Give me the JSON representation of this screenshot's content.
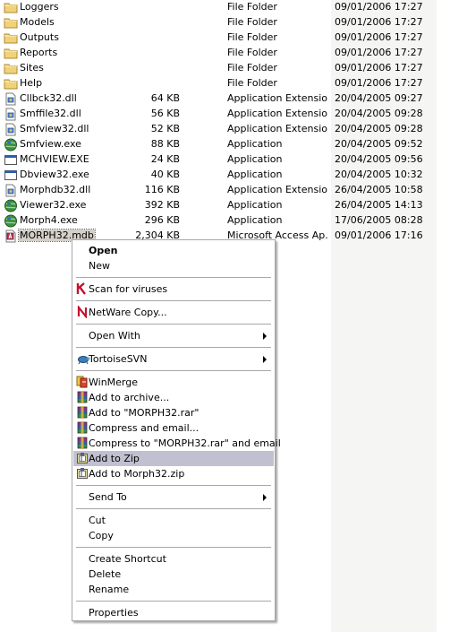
{
  "files": [
    {
      "name": "Loggers",
      "size": "",
      "type": "File Folder",
      "date": "09/01/2006 17:27",
      "icon": "folder-icon"
    },
    {
      "name": "Models",
      "size": "",
      "type": "File Folder",
      "date": "09/01/2006 17:27",
      "icon": "folder-icon"
    },
    {
      "name": "Outputs",
      "size": "",
      "type": "File Folder",
      "date": "09/01/2006 17:27",
      "icon": "folder-icon"
    },
    {
      "name": "Reports",
      "size": "",
      "type": "File Folder",
      "date": "09/01/2006 17:27",
      "icon": "folder-icon"
    },
    {
      "name": "Sites",
      "size": "",
      "type": "File Folder",
      "date": "09/01/2006 17:27",
      "icon": "folder-icon"
    },
    {
      "name": "Help",
      "size": "",
      "type": "File Folder",
      "date": "09/01/2006 17:27",
      "icon": "folder-icon"
    },
    {
      "name": "Cllbck32.dll",
      "size": "64 KB",
      "type": "Application Extension",
      "date": "20/04/2005 09:27",
      "icon": "dll-icon"
    },
    {
      "name": "Smffile32.dll",
      "size": "56 KB",
      "type": "Application Extension",
      "date": "20/04/2005 09:28",
      "icon": "dll-icon"
    },
    {
      "name": "Smfview32.dll",
      "size": "52 KB",
      "type": "Application Extension",
      "date": "20/04/2005 09:28",
      "icon": "dll-icon"
    },
    {
      "name": "Smfview.exe",
      "size": "88 KB",
      "type": "Application",
      "date": "20/04/2005 09:52",
      "icon": "globe-app-icon"
    },
    {
      "name": "MCHVIEW.EXE",
      "size": "24 KB",
      "type": "Application",
      "date": "20/04/2005 09:56",
      "icon": "app-window-icon"
    },
    {
      "name": "Dbview32.exe",
      "size": "40 KB",
      "type": "Application",
      "date": "20/04/2005 10:32",
      "icon": "app-window-icon"
    },
    {
      "name": "Morphdb32.dll",
      "size": "116 KB",
      "type": "Application Extension",
      "date": "26/04/2005 10:58",
      "icon": "dll-icon"
    },
    {
      "name": "Viewer32.exe",
      "size": "392 KB",
      "type": "Application",
      "date": "26/04/2005 14:13",
      "icon": "globe-app-icon"
    },
    {
      "name": "Morph4.exe",
      "size": "296 KB",
      "type": "Application",
      "date": "17/06/2005 08:28",
      "icon": "globe-app-icon"
    },
    {
      "name": "MORPH32.mdb",
      "size": "2,304 KB",
      "type": "Microsoft Access Ap...",
      "date": "09/01/2006 17:16",
      "icon": "access-db-icon",
      "selected": true
    }
  ],
  "context_menu": {
    "items": [
      {
        "label": "Open",
        "bold": true,
        "icon": ""
      },
      {
        "label": "New",
        "icon": ""
      },
      {
        "sep": true
      },
      {
        "label": "Scan for viruses",
        "icon": "antivirus-k-icon"
      },
      {
        "sep": true
      },
      {
        "label": "NetWare Copy...",
        "icon": "netware-n-icon"
      },
      {
        "sep": true
      },
      {
        "label": "Open With",
        "icon": "",
        "submenu": true
      },
      {
        "sep": true
      },
      {
        "label": "TortoiseSVN",
        "icon": "tortoise-icon",
        "submenu": true
      },
      {
        "sep": true
      },
      {
        "label": "WinMerge",
        "icon": "winmerge-icon"
      },
      {
        "label": "Add to archive...",
        "icon": "winrar-icon"
      },
      {
        "label": "Add to \"MORPH32.rar\"",
        "icon": "winrar-icon"
      },
      {
        "label": "Compress and email...",
        "icon": "winrar-icon"
      },
      {
        "label": "Compress to \"MORPH32.rar\" and email",
        "icon": "winrar-icon"
      },
      {
        "label": "Add to Zip",
        "icon": "winzip-icon",
        "highlighted": true
      },
      {
        "label": "Add to Morph32.zip",
        "icon": "winzip-icon"
      },
      {
        "sep": true
      },
      {
        "label": "Send To",
        "icon": "",
        "submenu": true
      },
      {
        "sep": true
      },
      {
        "label": "Cut",
        "icon": ""
      },
      {
        "label": "Copy",
        "icon": ""
      },
      {
        "sep": true
      },
      {
        "label": "Create Shortcut",
        "icon": ""
      },
      {
        "label": "Delete",
        "icon": ""
      },
      {
        "label": "Rename",
        "icon": ""
      },
      {
        "sep": true
      },
      {
        "label": "Properties",
        "icon": ""
      }
    ]
  },
  "colors": {
    "selection_bg": "#c1c0d0",
    "folder": "#f0d27a",
    "shaded_column": "#f5f5f3",
    "menu_border": "#a7a6aa"
  }
}
